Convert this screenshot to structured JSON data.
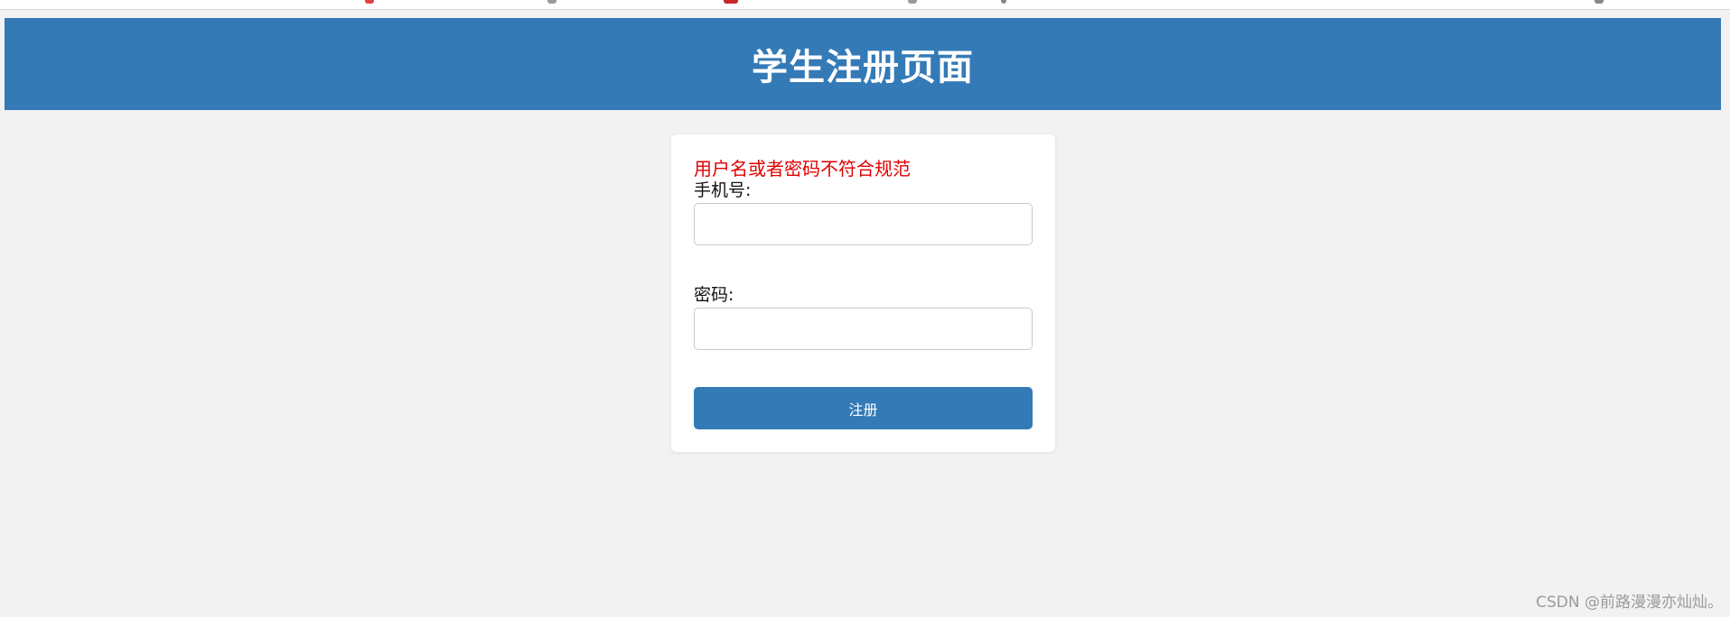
{
  "header": {
    "title": "学生注册页面"
  },
  "form": {
    "error_message": "用户名或者密码不符合规范",
    "phone_label": "手机号:",
    "phone_value": "",
    "password_label": "密码:",
    "password_value": "",
    "submit_label": "注册"
  },
  "watermark": "CSDN @前路漫漫亦灿灿。",
  "colors": {
    "header_background": "#337ab7",
    "page_background": "#f2f2f2",
    "error_text": "#e00000",
    "button_background": "#337ab7"
  }
}
